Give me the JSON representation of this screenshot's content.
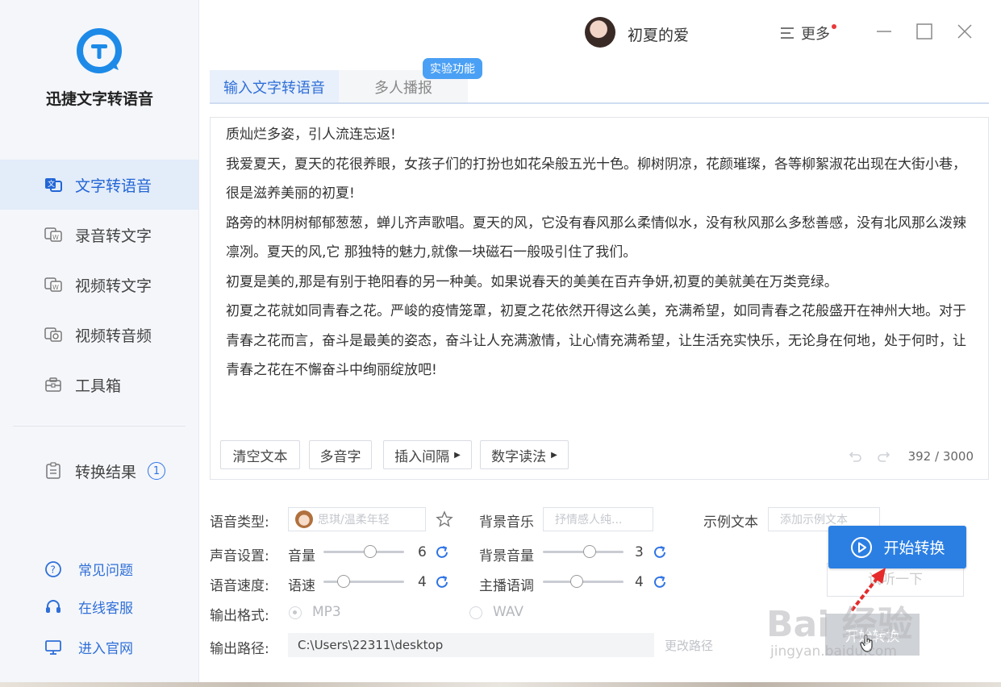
{
  "app": {
    "name": "迅捷文字转语音"
  },
  "sidebar": {
    "items": [
      {
        "label": "文字转语音",
        "icon": "text-to-speech-icon",
        "active": true
      },
      {
        "label": "录音转文字",
        "icon": "audio-to-text-icon"
      },
      {
        "label": "视频转文字",
        "icon": "video-to-text-icon"
      },
      {
        "label": "视频转音频",
        "icon": "video-to-audio-icon"
      },
      {
        "label": "工具箱",
        "icon": "toolbox-icon"
      }
    ],
    "results": {
      "label": "转换结果",
      "count": "1"
    },
    "footer": [
      {
        "label": "常见问题",
        "icon": "question-icon"
      },
      {
        "label": "在线客服",
        "icon": "headset-icon"
      },
      {
        "label": "进入官网",
        "icon": "monitor-icon"
      }
    ]
  },
  "header": {
    "username": "初夏的爱",
    "more_label": "更多"
  },
  "tabs": [
    {
      "label": "输入文字转语音",
      "active": true
    },
    {
      "label": "多人播报",
      "badge": "实验功能"
    }
  ],
  "editor": {
    "lines": [
      "质灿烂多姿，引人流连忘返!",
      "我爱夏天，夏天的花很养眼，女孩子们的打扮也如花朵般五光十色。柳树阴凉，花颜璀璨，各等柳絮淑花出现在大街小巷，",
      "很是滋养美丽的初夏!",
      "路旁的林阴树郁郁葱葱，蝉儿齐声歌唱。夏天的风，它没有春风那么柔情似水，没有秋风那么多愁善感，没有北风那么泼辣",
      "凛冽。夏天的风,它 那独特的魅力,就像一块磁石一般吸引住了我们。",
      "初夏是美的,那是有别于艳阳春的另一种美。如果说春天的美美在百卉争妍,初夏的美就美在万类竞绿。",
      "初夏之花就如同青春之花。严峻的疫情笼罩，初夏之花依然开得这么美，充满希望，如同青春之花般盛开在神州大地。对于",
      "青春之花而言，奋斗是最美的姿态，奋斗让人充满激情，让心情充满希望，让生活充实快乐，无论身在何地，处于何时，让",
      "青春之花在不懈奋斗中绚丽绽放吧!"
    ],
    "tools": {
      "clear": "清空文本",
      "polyphone": "多音字",
      "insert_pause": "插入间隔",
      "number_reading": "数字读法"
    },
    "char_count": "392 / 3000"
  },
  "settings": {
    "voice_type_label": "语音类型:",
    "voice_value": "思琪/温柔年轻",
    "bgm_label": "背景音乐",
    "bgm_placeholder": "抒情感人纯...",
    "sample_label": "示例文本",
    "sample_placeholder": "添加示例文本",
    "sound_label": "声音设置:",
    "volume_label": "音量",
    "volume_value": "6",
    "volume_fraction": 0.6,
    "bg_volume_label": "背景音量",
    "bg_volume_value": "3",
    "bg_volume_fraction": 0.6,
    "speed_label": "语音速度:",
    "speed_sub_label": "语速",
    "speed_value": "4",
    "speed_fraction": 0.2,
    "pitch_label": "主播语调",
    "pitch_value": "4",
    "pitch_fraction": 0.4,
    "format_label": "输出格式:",
    "format_mp3": "MP3",
    "format_wav": "WAV",
    "path_label": "输出路径:",
    "path_value": "C:\\Users\\22311\\desktop",
    "change_path": "更改路径"
  },
  "actions": {
    "start": "开始转换",
    "listen": "试听一下",
    "ghost": "开始转换"
  },
  "watermark": {
    "main": "Bai 经验",
    "sub": "jingyan.baidu.com"
  }
}
